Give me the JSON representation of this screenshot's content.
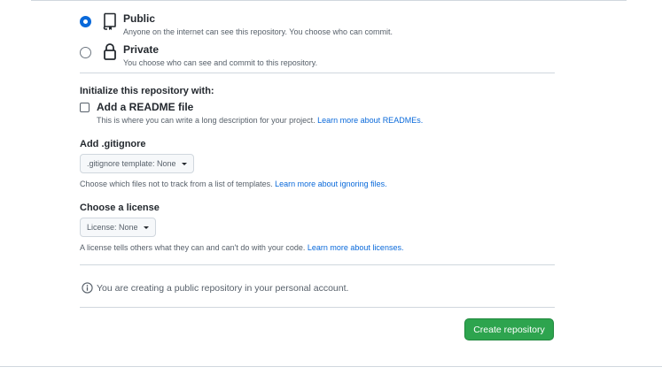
{
  "visibility": {
    "public": {
      "title": "Public",
      "description": "Anyone on the internet can see this repository. You choose who can commit."
    },
    "private": {
      "title": "Private",
      "description": "You choose who can see and commit to this repository."
    }
  },
  "initialize": {
    "heading": "Initialize this repository with:",
    "readme": {
      "title": "Add a README file",
      "description": "This is where you can write a long description for your project.",
      "link": "Learn more about READMEs."
    }
  },
  "gitignore": {
    "heading": "Add .gitignore",
    "dropdown_label": ".gitignore template: None",
    "help": "Choose which files not to track from a list of templates.",
    "help_link": "Learn more about ignoring files."
  },
  "license": {
    "heading": "Choose a license",
    "dropdown_label": "License: None",
    "help": "A license tells others what they can and can't do with your code.",
    "help_link": "Learn more about licenses."
  },
  "notice": {
    "text": "You are creating a public repository in your personal account."
  },
  "actions": {
    "create_label": "Create repository"
  },
  "colors": {
    "accent": "#0969da",
    "primary_button": "#2da44e"
  },
  "icons": {
    "public": "repo-icon",
    "private": "lock-icon",
    "notice": "info-icon",
    "dropdown": "caret-down-icon"
  }
}
